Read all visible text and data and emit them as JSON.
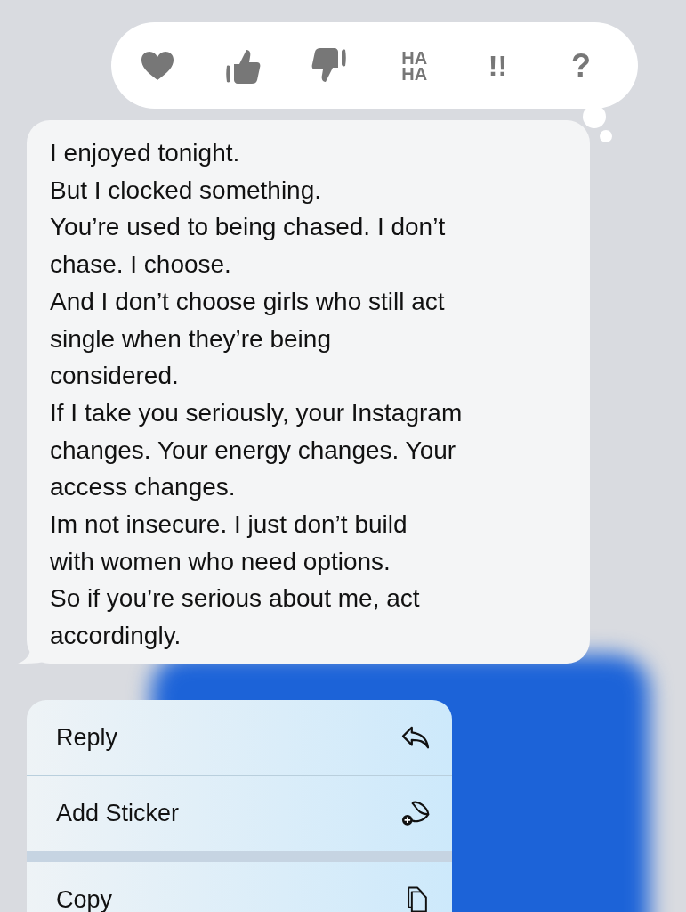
{
  "tapbacks": [
    {
      "kind": "heart"
    },
    {
      "kind": "thumbs-up"
    },
    {
      "kind": "thumbs-down"
    },
    {
      "kind": "text",
      "label": "HA HA"
    },
    {
      "kind": "text",
      "label": "!!"
    },
    {
      "kind": "text",
      "label": "?"
    }
  ],
  "message": {
    "lines": [
      "I enjoyed tonight.",
      "But I clocked something.",
      "You’re used to being chased. I don’t",
      "chase. I choose.",
      "And I don’t choose girls who still act",
      "single when they’re being",
      "considered.",
      "If I take you seriously, your Instagram",
      "changes. Your energy changes. Your",
      "access changes.",
      "Im not insecure. I just don’t build",
      "with women who need options.",
      "So if you’re serious about me, act",
      "accordingly."
    ]
  },
  "menu": [
    {
      "label": "Reply",
      "kind": "reply"
    },
    {
      "label": "Add Sticker",
      "kind": "sticker"
    },
    {
      "label": "Copy",
      "kind": "copy"
    }
  ]
}
